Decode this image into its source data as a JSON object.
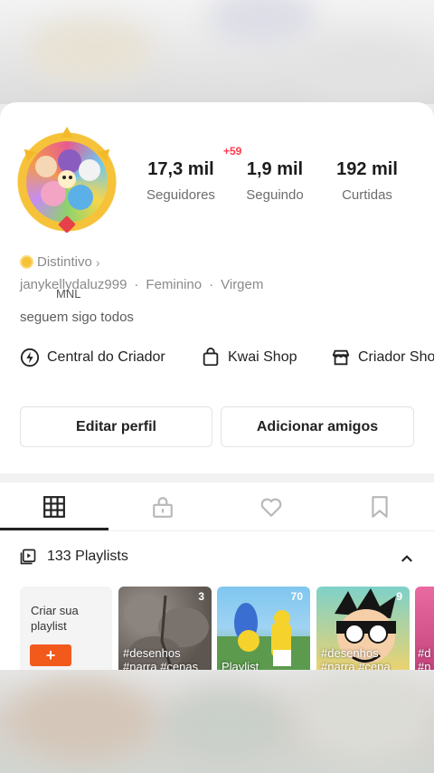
{
  "profile": {
    "new_badge": "+59",
    "stats": [
      {
        "value": "17,3 mil",
        "label": "Seguidores"
      },
      {
        "value": "1,9 mil",
        "label": "Seguindo"
      },
      {
        "value": "192 mil",
        "label": "Curtidas"
      }
    ],
    "badge_label": "Distintivo",
    "username": "janykellydaluz999",
    "overlay_text": "MNL",
    "gender": "Feminino",
    "sign": "Virgem",
    "bio": "seguem sigo todos"
  },
  "links": [
    {
      "label": "Central do Criador",
      "icon": "bolt-circle-icon"
    },
    {
      "label": "Kwai Shop",
      "icon": "shopping-bag-icon"
    },
    {
      "label": "Criador Shop",
      "icon": "store-icon"
    }
  ],
  "buttons": {
    "edit": "Editar perfil",
    "add_friends": "Adicionar amigos"
  },
  "tabs": [
    {
      "name": "grid-icon",
      "active": true
    },
    {
      "name": "lock-icon",
      "active": false
    },
    {
      "name": "heart-icon",
      "active": false
    },
    {
      "name": "bookmark-icon",
      "active": false
    }
  ],
  "playlists": {
    "title": "133 Playlists",
    "create_label": "Criar sua playlist",
    "create_button": "+",
    "items": [
      {
        "count": "3",
        "caption1": "#desenhos",
        "caption2": "#narra #cenas"
      },
      {
        "count": "70",
        "caption1": "Playlist",
        "caption2": ""
      },
      {
        "count": "9",
        "caption1": "#desenhos",
        "caption2": "#narra #cena"
      },
      {
        "count": "",
        "caption1": "#d",
        "caption2": "#n"
      }
    ]
  },
  "colors": {
    "accent": "#f25a1c",
    "badge_red": "#ff3a4d",
    "coin": "#f6c23a"
  }
}
